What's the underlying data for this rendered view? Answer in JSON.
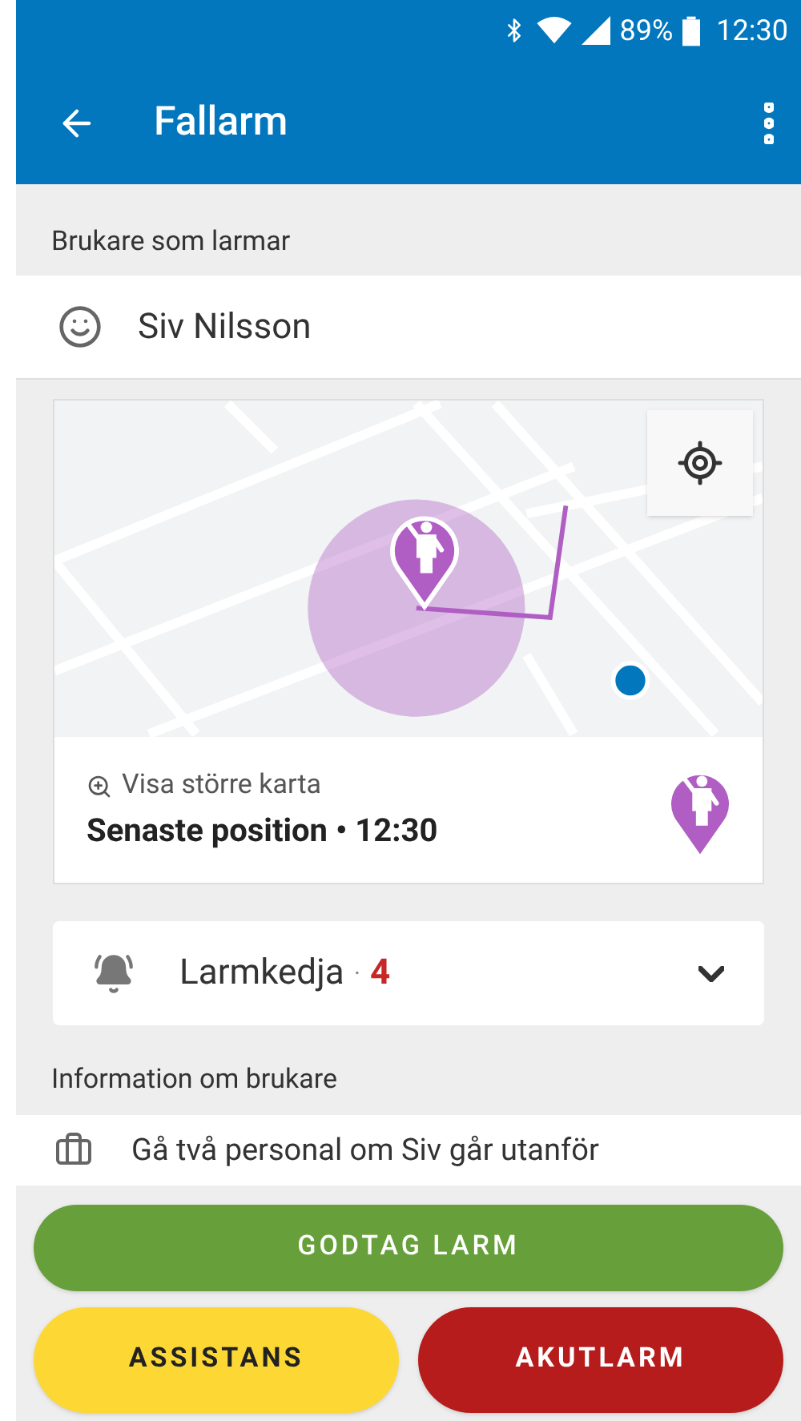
{
  "status_bar": {
    "battery": "89%",
    "time": "12:30"
  },
  "app_bar": {
    "title": "Fallarm"
  },
  "caller_section": {
    "heading": "Brukare som larmar",
    "name": "Siv Nilsson"
  },
  "map_card": {
    "link": "Visa större karta",
    "position": "Senaste position • 12:30"
  },
  "alarm_chain": {
    "label": "Larmkedja",
    "separator": "·",
    "count": "4",
    "expanded": false
  },
  "info_section": {
    "heading": "Information om brukare",
    "text": "Gå två personal om Siv går utanför"
  },
  "buttons": [
    {
      "label": "GODTAG LARM",
      "kind": "accept"
    },
    {
      "label": "ASSISTANS",
      "kind": "assist"
    },
    {
      "label": "AKUTLARM",
      "kind": "emergency"
    }
  ]
}
